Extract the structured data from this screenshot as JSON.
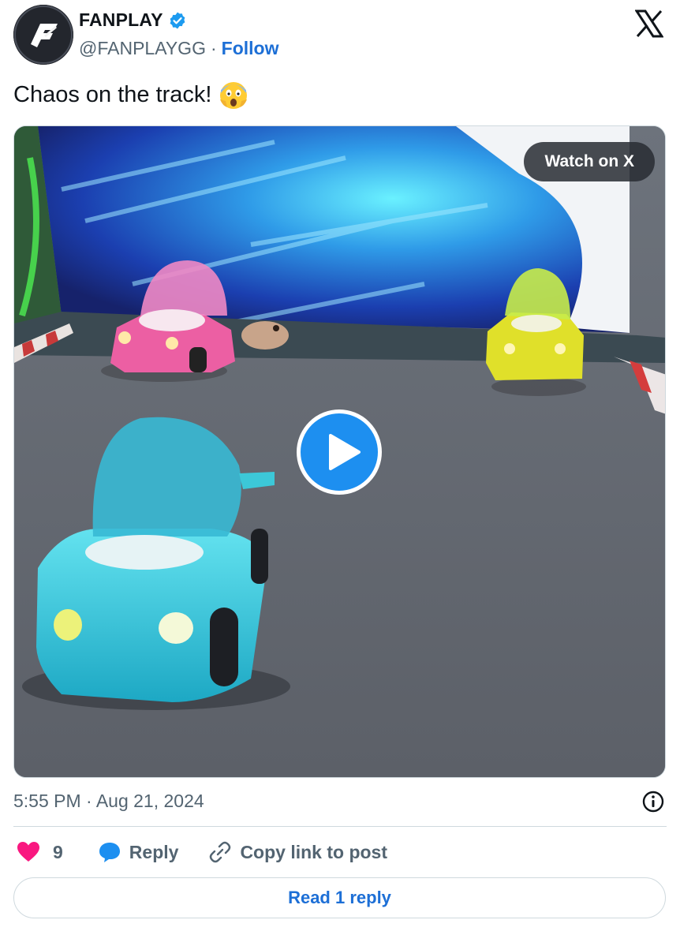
{
  "author": {
    "display_name": "FANPLAY",
    "handle": "@FANPLAYGG",
    "separator": "·",
    "follow_label": "Follow",
    "verified": true,
    "avatar_icon": "fanplay-logo-icon"
  },
  "tweet": {
    "text": "Chaos on the track!",
    "emoji": "face-screaming-in-fear-icon"
  },
  "media": {
    "watch_label": "Watch on X",
    "play_icon": "play-icon",
    "type": "video"
  },
  "meta": {
    "timestamp": "5:55 PM · Aug 21, 2024"
  },
  "actions": {
    "like_count": "9",
    "reply_label": "Reply",
    "copy_label": "Copy link to post"
  },
  "footer": {
    "read_replies_label": "Read 1 reply"
  },
  "colors": {
    "accent": "#1d6fd6",
    "verified": "#1d9bf0",
    "like": "#f91880",
    "muted": "#536471"
  }
}
